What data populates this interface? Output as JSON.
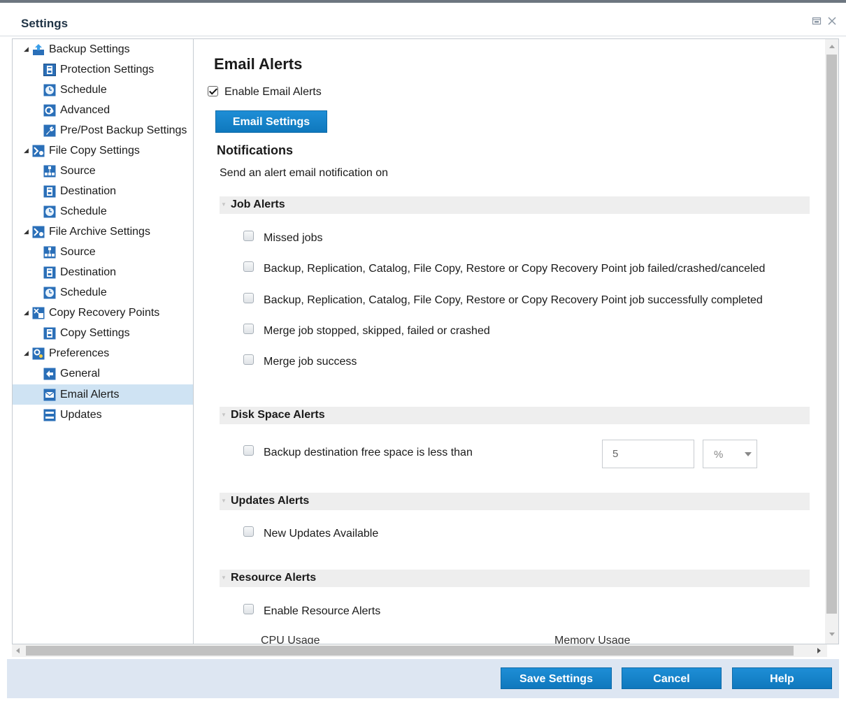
{
  "window": {
    "title": "Settings",
    "restore_icon": "restore-icon",
    "close_icon": "close-icon"
  },
  "tree": {
    "items": [
      {
        "label": "Backup Settings",
        "level": 0,
        "expanded": true,
        "icon": "backup-settings-icon"
      },
      {
        "label": "Protection Settings",
        "level": 1,
        "icon": "protection-settings-icon"
      },
      {
        "label": "Schedule",
        "level": 1,
        "icon": "schedule-icon"
      },
      {
        "label": "Advanced",
        "level": 1,
        "icon": "advanced-icon"
      },
      {
        "label": "Pre/Post Backup Settings",
        "level": 1,
        "icon": "wrench-icon"
      },
      {
        "label": "File Copy Settings",
        "level": 0,
        "expanded": true,
        "icon": "file-copy-icon"
      },
      {
        "label": "Source",
        "level": 1,
        "icon": "source-icon"
      },
      {
        "label": "Destination",
        "level": 1,
        "icon": "destination-icon"
      },
      {
        "label": "Schedule",
        "level": 1,
        "icon": "schedule-icon"
      },
      {
        "label": "File Archive Settings",
        "level": 0,
        "expanded": true,
        "icon": "file-archive-icon"
      },
      {
        "label": "Source",
        "level": 1,
        "icon": "source-icon"
      },
      {
        "label": "Destination",
        "level": 1,
        "icon": "destination-icon"
      },
      {
        "label": "Schedule",
        "level": 1,
        "icon": "schedule-icon"
      },
      {
        "label": "Copy Recovery Points",
        "level": 0,
        "expanded": true,
        "icon": "copy-recovery-points-icon"
      },
      {
        "label": "Copy Settings",
        "level": 1,
        "icon": "destination-icon"
      },
      {
        "label": "Preferences",
        "level": 0,
        "expanded": true,
        "icon": "preferences-icon"
      },
      {
        "label": "General",
        "level": 1,
        "icon": "general-icon"
      },
      {
        "label": "Email Alerts",
        "level": 1,
        "selected": true,
        "icon": "email-icon"
      },
      {
        "label": "Updates",
        "level": 1,
        "icon": "updates-icon"
      }
    ]
  },
  "content": {
    "title": "Email Alerts",
    "enable_label": "Enable Email Alerts",
    "enable_checked": true,
    "email_settings_button": "Email Settings",
    "notifications_heading": "Notifications",
    "notifications_intro": "Send an alert email notification on",
    "job_alerts": {
      "title": "Job Alerts",
      "items": [
        {
          "label": "Missed jobs",
          "checked": false
        },
        {
          "label": "Backup, Replication, Catalog, File Copy, Restore or Copy Recovery Point job failed/crashed/canceled",
          "checked": false
        },
        {
          "label": "Backup, Replication, Catalog, File Copy, Restore or Copy Recovery Point job successfully completed",
          "checked": false
        },
        {
          "label": "Merge job stopped, skipped, failed or crashed",
          "checked": false
        },
        {
          "label": "Merge job success",
          "checked": false
        }
      ]
    },
    "disk_space_alerts": {
      "title": "Disk Space Alerts",
      "item_label": "Backup destination free space is less than",
      "checked": false,
      "threshold_value": "5",
      "unit_selected": "%"
    },
    "updates_alerts": {
      "title": "Updates Alerts",
      "item_label": "New Updates Available",
      "checked": false
    },
    "resource_alerts": {
      "title": "Resource Alerts",
      "item_label": "Enable Resource Alerts",
      "checked": false,
      "cpu_label": "CPU Usage",
      "memory_label": "Memory Usage"
    }
  },
  "footer": {
    "save_label": "Save Settings",
    "cancel_label": "Cancel",
    "help_label": "Help"
  },
  "colors": {
    "accent": "#1584cb",
    "footer_bg": "#dde6f2",
    "selection": "#cfe3f3"
  }
}
